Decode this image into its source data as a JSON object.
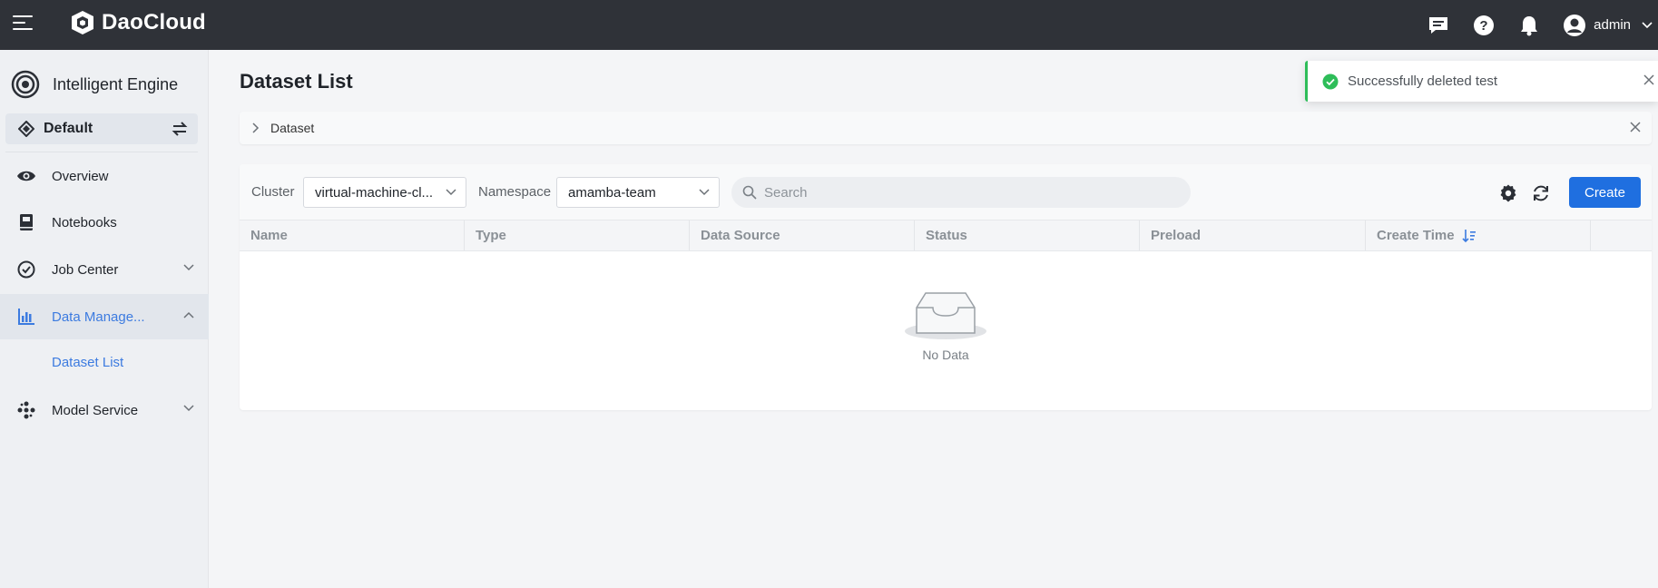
{
  "topbar": {
    "brand": "DaoCloud",
    "icons": [
      "menu-icon",
      "message-icon",
      "help-icon",
      "bell-icon",
      "user-avatar-icon",
      "chevron-down-icon"
    ],
    "user_name": "admin"
  },
  "sidebar": {
    "module_title": "Intelligent Engine",
    "workspace": "Default",
    "items": [
      {
        "label": "Overview",
        "icon": "eye-icon"
      },
      {
        "label": "Notebooks",
        "icon": "notebook-icon"
      },
      {
        "label": "Job Center",
        "icon": "check-circle-icon",
        "expandable": true
      },
      {
        "label": "Data Manage...",
        "icon": "chart-icon",
        "expandable": true,
        "expanded": true,
        "active": true
      },
      {
        "label": "Model Service",
        "icon": "model-icon",
        "expandable": true
      }
    ],
    "sub_items": [
      {
        "label": "Dataset List",
        "active": true
      }
    ]
  },
  "main": {
    "title": "Dataset List",
    "breadcrumb": "Dataset",
    "filters": {
      "cluster_label": "Cluster",
      "cluster_value": "virtual-machine-cl...",
      "namespace_label": "Namespace",
      "namespace_value": "amamba-team",
      "search_placeholder": "Search"
    },
    "create_label": "Create",
    "columns": [
      "Name",
      "Type",
      "Data Source",
      "Status",
      "Preload",
      "Create Time"
    ],
    "empty_text": "No Data"
  },
  "toast": {
    "message": "Successfully deleted test",
    "status_color": "#2ebd59"
  },
  "colors": {
    "accent": "#1f6fe0",
    "topbar": "#2f3238",
    "active_text": "#3c7be0"
  }
}
